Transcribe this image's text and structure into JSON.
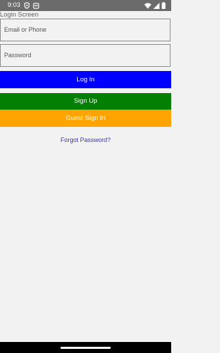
{
  "status_bar": {
    "time": "9:03",
    "left_icons": [
      "shield-icon",
      "gmail-icon"
    ],
    "right_icons": [
      "wifi-icon",
      "signal-icon",
      "battery-icon"
    ]
  },
  "screen": {
    "title": "Login Screen"
  },
  "form": {
    "email_placeholder": "Email or Phone",
    "password_placeholder": "Password"
  },
  "buttons": {
    "login": "Log In",
    "signup": "Sign Up",
    "guest": "Guest Sign In"
  },
  "links": {
    "forgot_password": "Forgot Password?"
  },
  "colors": {
    "login": "#0000ff",
    "signup": "#037f03",
    "guest": "#ffa400",
    "link": "#3a35c9",
    "background": "#f2f2f2"
  }
}
